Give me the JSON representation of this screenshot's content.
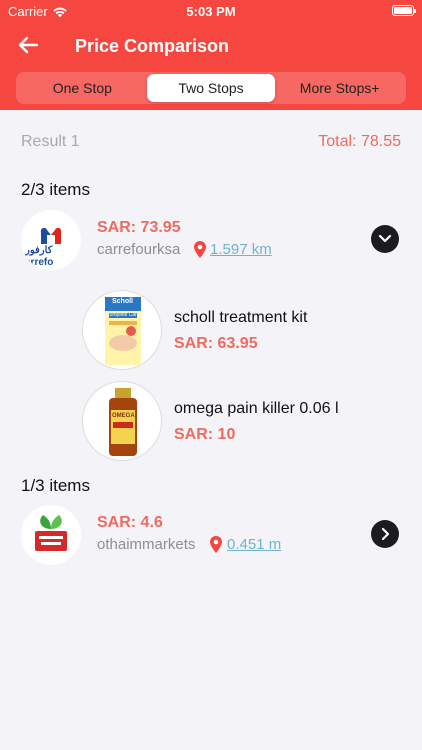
{
  "status_bar": {
    "carrier": "Carrier",
    "time": "5:03 PM"
  },
  "header": {
    "title": "Price Comparison",
    "tabs": [
      {
        "label": "One Stop",
        "active": false
      },
      {
        "label": "Two Stops",
        "active": true
      },
      {
        "label": "More Stops+",
        "active": false
      }
    ]
  },
  "result": {
    "label": "Result 1",
    "total": "Total: 78.55"
  },
  "groups": [
    {
      "title": "2/3 items",
      "store": {
        "price": "SAR: 73.95",
        "name": "carrefourksa",
        "distance": "1.597 km",
        "logo_text": "كارفور",
        "logo_latin": "arrefo",
        "toggle_icon": "chevron-down-icon"
      },
      "items": [
        {
          "name": "scholl treatment kit",
          "price": "SAR: 63.95",
          "image_label": "Scholl",
          "image_caption": "Complete Care"
        },
        {
          "name": "omega pain killer 0.06 l",
          "price": "SAR: 10",
          "image_label": "OMEGA"
        }
      ]
    },
    {
      "title": "1/3 items",
      "store": {
        "price": "SAR: 4.6",
        "name": "othaimmarkets",
        "distance": "0.451 m",
        "toggle_icon": "chevron-right-icon"
      }
    }
  ],
  "colors": {
    "header": "#f5473f",
    "price": "#ef6a5f",
    "distance": "#6fb3cf",
    "muted": "#8e8e93"
  }
}
